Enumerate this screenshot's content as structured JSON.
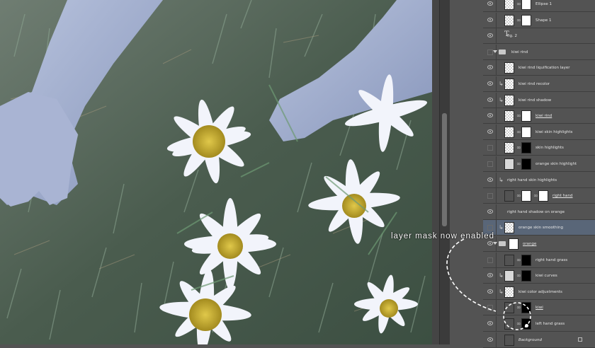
{
  "annotation": {
    "text": "layer mask now enabled"
  },
  "layers": [
    {
      "name": "Ellipse 1",
      "eye": true,
      "clip": false,
      "thumbs": [
        "trans",
        "white"
      ],
      "style": ""
    },
    {
      "name": "Shape 1",
      "eye": true,
      "clip": false,
      "thumbs": [
        "trans",
        "white"
      ],
      "style": ""
    },
    {
      "name": "fig. 2",
      "eye": true,
      "type": "text",
      "style": ""
    },
    {
      "name": "kiwi rind",
      "eye": false,
      "type": "group",
      "style": ""
    },
    {
      "name": "kiwi rind liquification layer",
      "eye": true,
      "thumbs": [
        "trans"
      ],
      "style": ""
    },
    {
      "name": "kiwi rind recolor",
      "eye": true,
      "clip": true,
      "thumbs": [
        "trans"
      ],
      "style": ""
    },
    {
      "name": "kiwi rind shadow",
      "eye": true,
      "clip": true,
      "thumbs": [
        "trans"
      ],
      "style": ""
    },
    {
      "name": "kiwi rind",
      "eye": true,
      "thumbs": [
        "trans",
        "white"
      ],
      "style": "u"
    },
    {
      "name": "kiwi skin highlights",
      "eye": true,
      "thumbs": [
        "trans",
        "white"
      ],
      "style": ""
    },
    {
      "name": "skin highlights",
      "eye": false,
      "thumbs": [
        "trans",
        "black"
      ],
      "style": ""
    },
    {
      "name": "orange skin highlight",
      "eye": false,
      "thumbs": [
        "adj",
        "black"
      ],
      "style": ""
    },
    {
      "name": "right hand skin highlights",
      "eye": true,
      "clip": true,
      "thumbs": [],
      "style": ""
    },
    {
      "name": "right hand",
      "eye": false,
      "thumbs": [
        "photo",
        "white",
        "white"
      ],
      "style": "u"
    },
    {
      "name": "right hand shadow on orange",
      "eye": true,
      "thumbs": [],
      "style": ""
    },
    {
      "name": "orange skin smoothing",
      "eye": false,
      "clip": true,
      "thumbs": [
        "trans"
      ],
      "style": "",
      "selected": true
    },
    {
      "name": "orange",
      "eye": true,
      "type": "group",
      "thumbs": [
        "white"
      ],
      "style": "u"
    },
    {
      "name": "right hand grass",
      "eye": false,
      "thumbs": [
        "photo",
        "black"
      ],
      "style": ""
    },
    {
      "name": "kiwi curves",
      "eye": true,
      "clip": true,
      "thumbs": [
        "adj",
        "black"
      ],
      "style": ""
    },
    {
      "name": "kiwi color adjustments",
      "eye": true,
      "clip": true,
      "thumbs": [
        "trans"
      ],
      "style": ""
    },
    {
      "name": "kiwi",
      "eye": false,
      "thumbs": [
        "photo",
        "black"
      ],
      "style": "u"
    },
    {
      "name": "left hand grass",
      "eye": true,
      "thumbs": [
        "photo",
        "black-spot"
      ],
      "style": ""
    },
    {
      "name": "Background",
      "eye": true,
      "thumbs": [
        "photo"
      ],
      "style": "it",
      "lock": true
    }
  ]
}
